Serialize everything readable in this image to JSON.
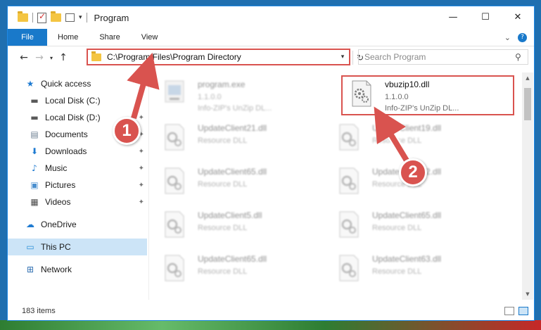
{
  "window": {
    "title": "Program",
    "controls": {
      "minimize": "—",
      "maximize": "☐",
      "close": "✕"
    }
  },
  "ribbon": {
    "tabs": [
      {
        "label": "File"
      },
      {
        "label": "Home"
      },
      {
        "label": "Share"
      },
      {
        "label": "View"
      }
    ],
    "expand_glyph": "⌄",
    "help_glyph": "?"
  },
  "navigation": {
    "back": "←",
    "forward": "→",
    "recent_caret": "▾",
    "up": "↑",
    "address": "C:\\Program Files\\Program Directory",
    "address_caret": "▾",
    "refresh": "↻",
    "search_placeholder": "Search Program",
    "search_glyph": "⚲"
  },
  "sidebar": {
    "items": [
      {
        "label": "Quick access",
        "icon": "star-icon",
        "glyph": "★",
        "color": "#1f7bd1",
        "pinned": false
      },
      {
        "label": "Local Disk (C:)",
        "icon": "drive-icon",
        "glyph": "▬",
        "color": "#5a5a5a",
        "pinned": true
      },
      {
        "label": "Local Disk (D:)",
        "icon": "drive-icon",
        "glyph": "▬",
        "color": "#5a5a5a",
        "pinned": true
      },
      {
        "label": "Documents",
        "icon": "documents-icon",
        "glyph": "▤",
        "color": "#6d7f92",
        "pinned": true
      },
      {
        "label": "Downloads",
        "icon": "download-icon",
        "glyph": "⬇",
        "color": "#1f7bd1",
        "pinned": true
      },
      {
        "label": "Music",
        "icon": "music-icon",
        "glyph": "♪",
        "color": "#1f7bd1",
        "pinned": true
      },
      {
        "label": "Pictures",
        "icon": "pictures-icon",
        "glyph": "▣",
        "color": "#4a8fcf",
        "pinned": true
      },
      {
        "label": "Videos",
        "icon": "videos-icon",
        "glyph": "▦",
        "color": "#4a4a4a",
        "pinned": true
      },
      {
        "label": "OneDrive",
        "icon": "cloud-icon",
        "glyph": "☁",
        "color": "#1f7bd1",
        "pinned": false
      },
      {
        "label": "This PC",
        "icon": "computer-icon",
        "glyph": "▭",
        "color": "#2b8fd8",
        "pinned": false,
        "selected": true
      },
      {
        "label": "Network",
        "icon": "network-icon",
        "glyph": "⊞",
        "color": "#2b6cb0",
        "pinned": false
      }
    ],
    "pin_glyph": "📌"
  },
  "files": [
    {
      "name": "program.exe",
      "line1": "1.1.0.0",
      "line2": "Info-ZIP's UnZip DL...",
      "blurred": true
    },
    {
      "name": "vbuzip10.dll",
      "line1": "1.1.0.0",
      "line2": "Info-ZIP's UnZip DL...",
      "blurred": false
    },
    {
      "name": "UpdateClient21.dll",
      "line1": "Resource DLL",
      "line2": "",
      "blurred": true
    },
    {
      "name": "UpdateClient19.dll",
      "line1": "Resource DLL",
      "line2": "",
      "blurred": true
    },
    {
      "name": "UpdateClient65.dll",
      "line1": "Resource DLL",
      "line2": "",
      "blurred": true
    },
    {
      "name": "UpdateClient42.dll",
      "line1": "Resource DLL",
      "line2": "",
      "blurred": true
    },
    {
      "name": "UpdateClient5.dll",
      "line1": "Resource DLL",
      "line2": "",
      "blurred": true
    },
    {
      "name": "UpdateClient65.dll",
      "line1": "Resource DLL",
      "line2": "",
      "blurred": true
    },
    {
      "name": "UpdateClient65.dll",
      "line1": "Resource DLL",
      "line2": "",
      "blurred": true
    },
    {
      "name": "UpdateClient63.dll",
      "line1": "Resource DLL",
      "line2": "",
      "blurred": true
    }
  ],
  "status": {
    "item_count": "183 items"
  },
  "scrollbar": {
    "up_glyph": "▲",
    "down_glyph": "▼"
  },
  "annotations": [
    {
      "label": "1"
    },
    {
      "label": "2"
    }
  ],
  "colors": {
    "accent": "#1979ca",
    "highlight": "#d9534f",
    "selection": "#cce4f7"
  }
}
